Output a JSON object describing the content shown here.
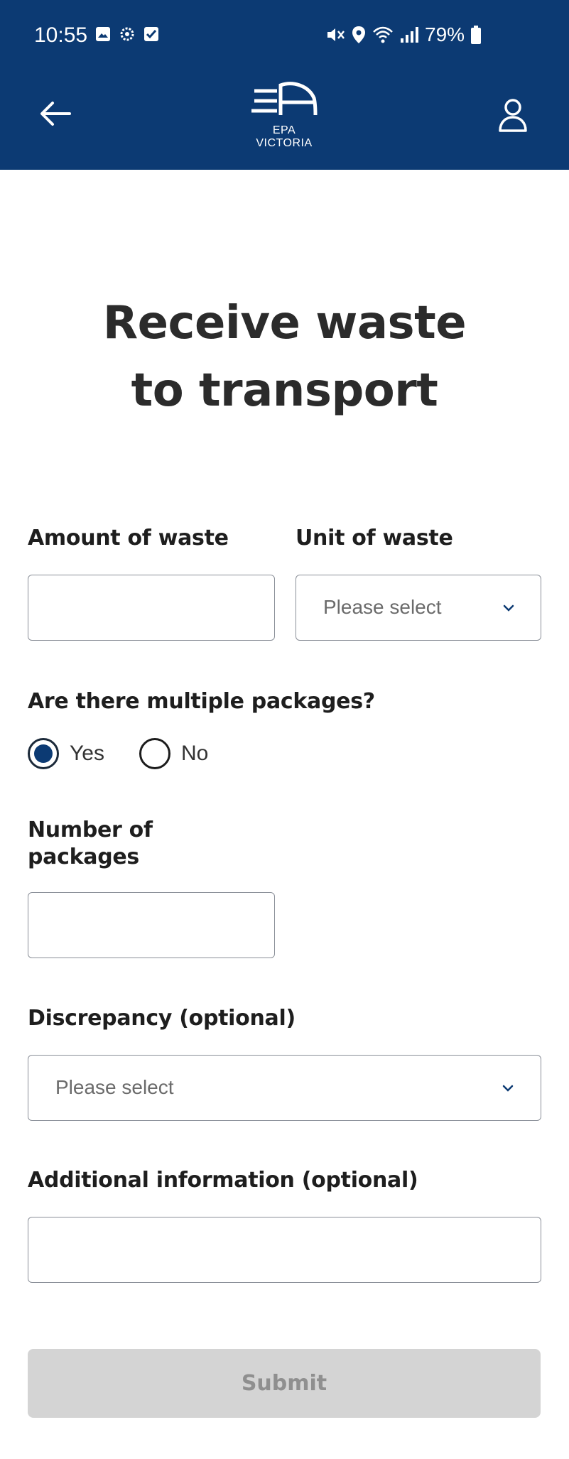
{
  "status_bar": {
    "time": "10:55",
    "battery": "79%"
  },
  "header": {
    "back_icon": "arrow-left-icon",
    "logo_line1": "EPA",
    "logo_line2": "VICTORIA",
    "profile_icon": "user-icon"
  },
  "page": {
    "title_line1": "Receive waste",
    "title_line2": "to transport"
  },
  "form": {
    "amount_label": "Amount of waste",
    "amount_value": "",
    "unit_label": "Unit of waste",
    "unit_value": "Please select",
    "multiple_packages_label": "Are there multiple packages?",
    "yes_label": "Yes",
    "no_label": "No",
    "multiple_packages_selected": "Yes",
    "number_label_line1": "Number of",
    "number_label_line2": "packages",
    "number_value": "",
    "discrepancy_label": "Discrepancy (optional)",
    "discrepancy_value": "Please select",
    "additional_label": "Additional information (optional)",
    "additional_value": "",
    "submit_label": "Submit"
  },
  "colors": {
    "header_bg": "#0c3a73",
    "radio_selected": "#0c3a73",
    "submit_disabled_bg": "#d4d4d4",
    "submit_disabled_text": "#8f8f8f"
  }
}
